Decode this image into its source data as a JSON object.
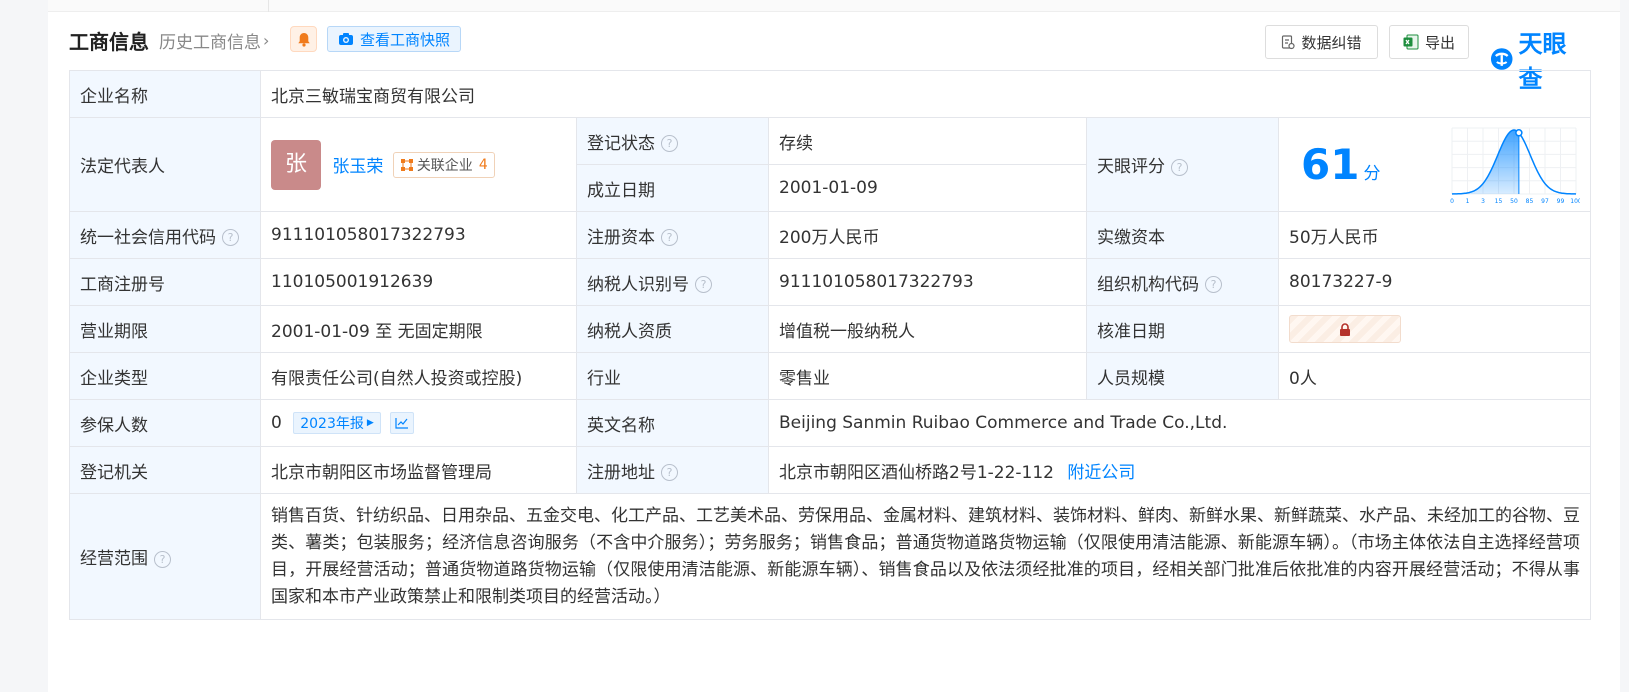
{
  "header": {
    "title": "工商信息",
    "history_link": "历史工商信息",
    "snapshot_button": "查看工商快照",
    "correct_button": "数据纠错",
    "export_button": "导出",
    "logo_text": "天眼查"
  },
  "labels": {
    "company_name": "企业名称",
    "legal_rep": "法定代表人",
    "reg_status": "登记状态",
    "founded": "成立日期",
    "tianyan_score": "天眼评分",
    "credit_code": "统一社会信用代码",
    "reg_capital": "注册资本",
    "paid_capital": "实缴资本",
    "reg_number": "工商注册号",
    "taxpayer_id": "纳税人识别号",
    "org_code": "组织机构代码",
    "term": "营业期限",
    "taxpayer_qual": "纳税人资质",
    "approval_date": "核准日期",
    "company_type": "企业类型",
    "industry": "行业",
    "staff_size": "人员规模",
    "insured": "参保人数",
    "english_name": "英文名称",
    "reg_authority": "登记机关",
    "reg_address": "注册地址",
    "scope": "经营范围"
  },
  "values": {
    "company_name": "北京三敏瑞宝商贸有限公司",
    "avatar_char": "张",
    "legal_rep_name": "张玉荣",
    "related_label": "关联企业",
    "related_count": "4",
    "reg_status": "存续",
    "founded": "2001-01-09",
    "score": "61",
    "score_unit": "分",
    "credit_code": "911101058017322793",
    "reg_capital": "200万人民币",
    "paid_capital": "50万人民币",
    "reg_number": "110105001912639",
    "taxpayer_id": "911101058017322793",
    "org_code": "80173227-9",
    "term": "2001-01-09 至 无固定期限",
    "taxpayer_qual": "增值税一般纳税人",
    "company_type": "有限责任公司(自然人投资或控股)",
    "industry": "零售业",
    "staff_size": "0人",
    "insured": "0",
    "insured_year": "2023年报",
    "english_name": "Beijing Sanmin Ruibao Commerce and Trade Co.,Ltd.",
    "reg_authority": "北京市朝阳区市场监督管理局",
    "reg_address": "北京市朝阳区酒仙桥路2号1-22-112",
    "nearby_link": "附近公司",
    "scope": "销售百货、针纺织品、日用杂品、五金交电、化工产品、工艺美术品、劳保用品、金属材料、建筑材料、装饰材料、鲜肉、新鲜水果、新鲜蔬菜、水产品、未经加工的谷物、豆类、薯类；包装服务；经济信息咨询服务（不含中介服务）；劳务服务；销售食品；普通货物道路货物运输（仅限使用清洁能源、新能源车辆）。（市场主体依法自主选择经营项目，开展经营活动；普通货物道路货物运输（仅限使用清洁能源、新能源车辆）、销售食品以及依法须经批准的项目，经相关部门批准后依批准的内容开展经营活动；不得从事国家和本市产业政策禁止和限制类项目的经营活动。）"
  },
  "score_chart": {
    "ticks": [
      "0",
      "1",
      "3",
      "15",
      "50",
      "85",
      "97",
      "99",
      "100"
    ],
    "marker": 61
  },
  "colors": {
    "accent": "#0084ff",
    "label_bg": "#f2f8ff",
    "status_green": "#19a05c",
    "related_orange": "#f07b1c",
    "lock": "#b5322a"
  }
}
